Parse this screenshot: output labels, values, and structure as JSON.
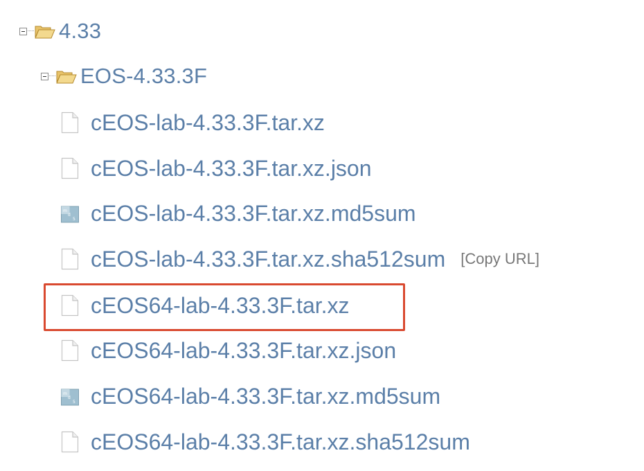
{
  "tree": {
    "folder_root": {
      "label": "4.33",
      "icon": "open-folder-icon"
    },
    "folder_sub": {
      "label": "EOS-4.33.3F",
      "icon": "open-folder-icon"
    },
    "files": [
      {
        "name": "cEOS-lab-4.33.3F.tar.xz",
        "icon": "document-icon"
      },
      {
        "name": "cEOS-lab-4.33.3F.tar.xz.json",
        "icon": "document-icon"
      },
      {
        "name": "cEOS-lab-4.33.3F.tar.xz.md5sum",
        "icon": "md5-file-icon"
      },
      {
        "name": "cEOS-lab-4.33.3F.tar.xz.sha512sum",
        "icon": "document-icon",
        "action": "[Copy URL]"
      },
      {
        "name": "cEOS64-lab-4.33.3F.tar.xz",
        "icon": "document-icon",
        "highlighted": true
      },
      {
        "name": "cEOS64-lab-4.33.3F.tar.xz.json",
        "icon": "document-icon"
      },
      {
        "name": "cEOS64-lab-4.33.3F.tar.xz.md5sum",
        "icon": "md5-file-icon"
      },
      {
        "name": "cEOS64-lab-4.33.3F.tar.xz.sha512sum",
        "icon": "document-icon"
      }
    ]
  },
  "colors": {
    "link": "#5b7fa8",
    "highlight": "#d9492f",
    "copy_url": "#777777"
  }
}
